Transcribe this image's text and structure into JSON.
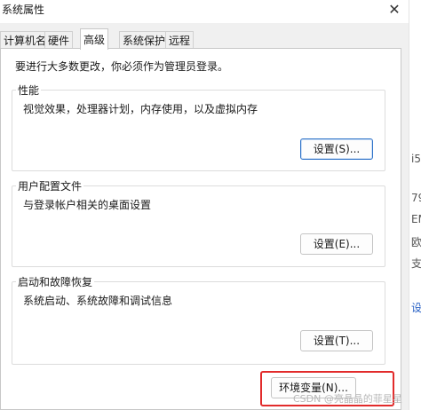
{
  "window": {
    "title": "系统属性"
  },
  "tabs": [
    {
      "label": "计算机名"
    },
    {
      "label": "硬件"
    },
    {
      "label": "高级",
      "active": true
    },
    {
      "label": "系统保护"
    },
    {
      "label": "远程"
    }
  ],
  "admin_note": "要进行大多数更改，你必须作为管理员登录。",
  "groups": {
    "performance": {
      "title": "性能",
      "description": "视觉效果，处理器计划，内存使用，以及虚拟内存",
      "button": "设置(S)..."
    },
    "user_profiles": {
      "title": "用户配置文件",
      "description": "与登录帐户相关的桌面设置",
      "button": "设置(E)..."
    },
    "startup_recovery": {
      "title": "启动和故障恢复",
      "description": "系统启动、系统故障和调试信息",
      "button": "设置(T)..."
    }
  },
  "env_button": "环境变量(N)...",
  "background_window": [
    "i5",
    "79-",
    "EM",
    "欧",
    "支",
    "设"
  ],
  "watermark": "CSDN @亮晶晶的菲星星",
  "colors": {
    "highlight": "#e22b2b",
    "default_button_border": "#2f73c9"
  },
  "icons": {
    "close": "close-icon"
  }
}
